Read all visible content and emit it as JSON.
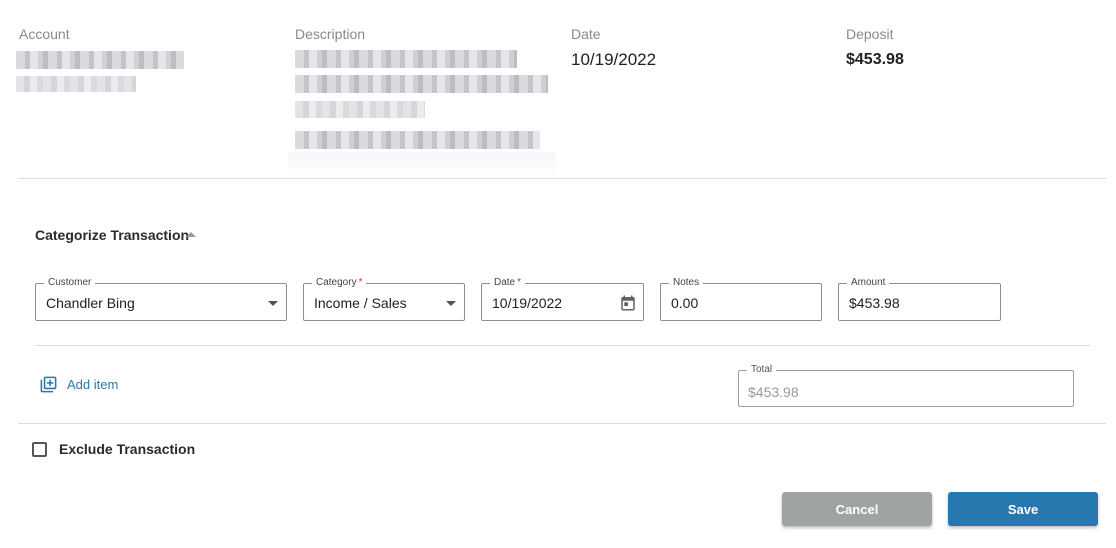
{
  "transaction": {
    "account_label": "Account",
    "description_label": "Description",
    "date_label": "Date",
    "date_value": "10/19/2022",
    "deposit_label": "Deposit",
    "deposit_value": "$453.98"
  },
  "categorize": {
    "title": "Categorize Transaction",
    "fields": {
      "customer": {
        "label": "Customer",
        "value": "Chandler Bing"
      },
      "category": {
        "label": "Category",
        "required": "*",
        "value": "Income / Sales"
      },
      "date": {
        "label": "Date",
        "required": "*",
        "value": "10/19/2022"
      },
      "notes": {
        "label": "Notes",
        "value": "0.00"
      },
      "amount": {
        "label": "Amount",
        "value": "$453.98"
      }
    },
    "add_item_label": "Add item",
    "total": {
      "label": "Total",
      "value": "$453.98"
    }
  },
  "exclude_label": "Exclude Transaction",
  "buttons": {
    "cancel": "Cancel",
    "save": "Save"
  },
  "colors": {
    "accent": "#2878b0",
    "cancel": "#9ea3a3",
    "required": "#d32f2f"
  }
}
